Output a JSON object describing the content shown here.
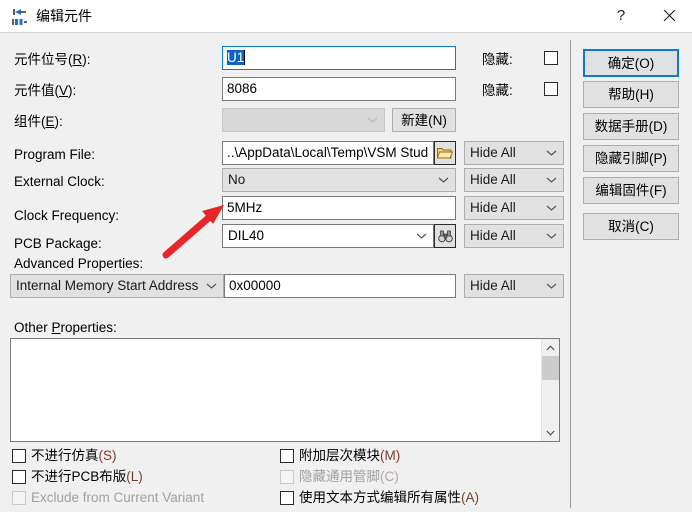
{
  "window": {
    "title": "编辑元件",
    "icon": "component-edit-icon",
    "help_button": "?",
    "close_button": "✕"
  },
  "form": {
    "reference": {
      "label_main": "元件位号(",
      "label_accel": "R",
      "label_tail": "):",
      "value": "U1",
      "hidden_label": "隐藏:",
      "hidden_checked": false
    },
    "value_field": {
      "label_main": "元件值(",
      "label_accel": "V",
      "label_tail": "):",
      "value": "8086",
      "hidden_label": "隐藏:",
      "hidden_checked": false
    },
    "element": {
      "label_main": "组件(",
      "label_accel": "E",
      "label_tail": "):",
      "value": "",
      "new_button": "新建(N)"
    },
    "rows": [
      {
        "label": "Program File:",
        "value": "..\\AppData\\Local\\Temp\\VSM Stud",
        "control": "textbox",
        "side_icon": "folder-open-icon",
        "hide": "Hide All"
      },
      {
        "label": "External Clock:",
        "value": "No",
        "control": "combobox-disabled",
        "side_icon": null,
        "hide": "Hide All"
      },
      {
        "label": "Clock Frequency:",
        "value": "5MHz",
        "control": "textbox",
        "side_icon": null,
        "hide": "Hide All"
      },
      {
        "label": "PCB Package:",
        "value": "DIL40",
        "control": "combobox",
        "side_icon": "binoculars-icon",
        "hide": "Hide All"
      }
    ],
    "advanced": {
      "label": "Advanced Properties:",
      "property": "Internal Memory Start Address",
      "value": "0x00000",
      "hide": "Hide All"
    },
    "other": {
      "label_main": "Other ",
      "label_accel": "P",
      "label_tail": "roperties:",
      "value": ""
    }
  },
  "buttons": [
    {
      "label": "确定(O)",
      "name": "ok-button",
      "default": true
    },
    {
      "label": "帮助(H)",
      "name": "help-button",
      "default": false
    },
    {
      "label": "数据手册(D)",
      "name": "datasheet-button",
      "default": false
    },
    {
      "label": "隐藏引脚(P)",
      "name": "hidden-pins-button",
      "default": false
    },
    {
      "label": "编辑固件(F)",
      "name": "edit-firmware-button",
      "default": false
    },
    {
      "label": "取消(C)",
      "name": "cancel-button",
      "default": false
    }
  ],
  "checkboxes_left": [
    {
      "text": "不进行仿真",
      "accel": "(S)",
      "checked": false,
      "disabled": false,
      "name": "exclude-from-simulation"
    },
    {
      "text": "不进行PCB布版",
      "accel": "(L)",
      "checked": false,
      "disabled": false,
      "name": "exclude-from-pcb-layout"
    },
    {
      "text": "Exclude from Current Variant",
      "accel": "",
      "checked": false,
      "disabled": true,
      "name": "exclude-from-current-variant"
    }
  ],
  "checkboxes_right": [
    {
      "text": "附加层次模块",
      "accel": "(M)",
      "checked": false,
      "disabled": false,
      "name": "attach-hierarchy-module"
    },
    {
      "text": "隐藏通用管脚",
      "accel": "(C)",
      "checked": false,
      "disabled": true,
      "name": "hide-common-pins"
    },
    {
      "text": "使用文本方式编辑所有属性",
      "accel": "(A)",
      "checked": false,
      "disabled": false,
      "name": "edit-all-properties-as-text"
    }
  ],
  "colors": {
    "accent": "#0a7ad6",
    "selection": "#0a64c8",
    "annotation_arrow": "#e8262a",
    "dialog_background": "#f0f0f0",
    "accelerator": "#7b3a28"
  }
}
